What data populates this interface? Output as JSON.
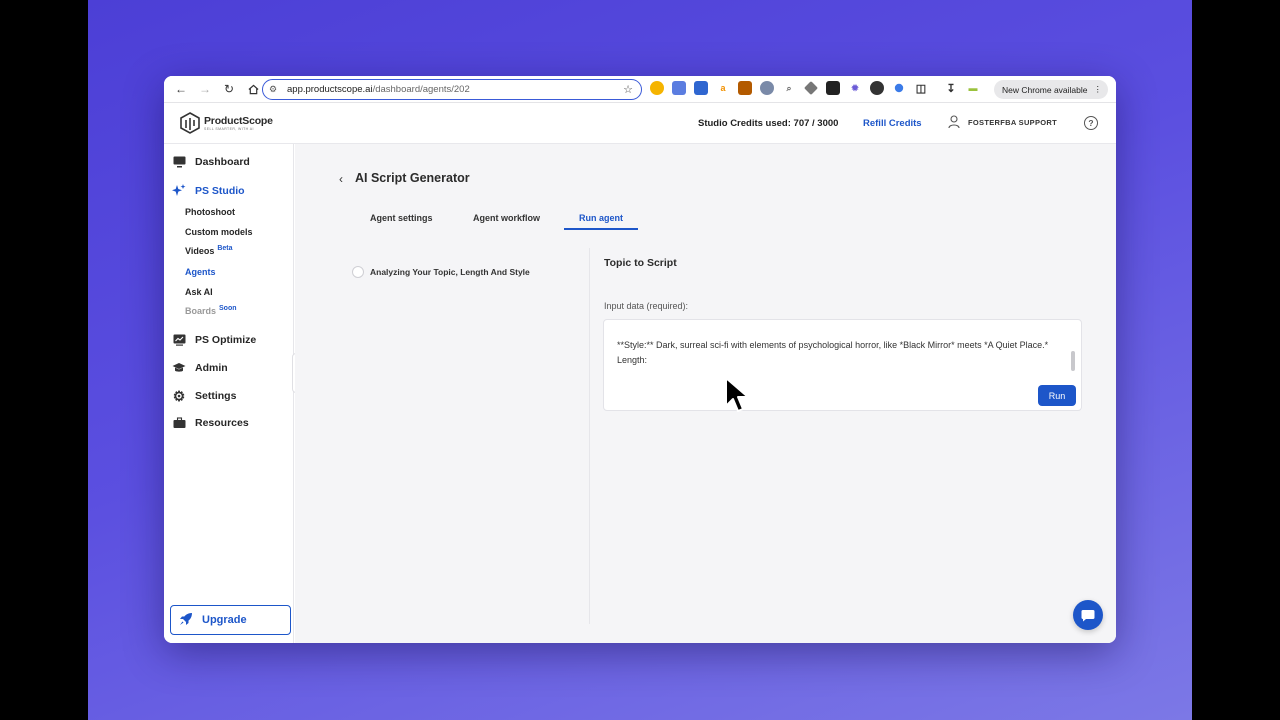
{
  "browser": {
    "url_host": "app.productscope.ai",
    "url_path": "/dashboard/agents/202",
    "new_chrome_label": "New Chrome available"
  },
  "header": {
    "brand_name": "ProductScope",
    "brand_tagline": "SELL SMARTER, WITH AI",
    "credits_label": "Studio Credits used: 707 / 3000",
    "refill_label": "Refill Credits",
    "user_name": "FOSTERFBA SUPPORT"
  },
  "sidebar": {
    "dashboard": "Dashboard",
    "ps_studio": "PS Studio",
    "studio_items": {
      "photoshoot": "Photoshoot",
      "custom_models": "Custom models",
      "videos": "Videos",
      "videos_badge": "Beta",
      "agents": "Agents",
      "ask_ai": "Ask AI",
      "boards": "Boards",
      "boards_badge": "Soon"
    },
    "ps_optimize": "PS Optimize",
    "admin": "Admin",
    "settings": "Settings",
    "resources": "Resources",
    "upgrade": "Upgrade"
  },
  "main": {
    "title": "AI Script Generator",
    "tabs": {
      "agent_settings": "Agent settings",
      "agent_workflow": "Agent workflow",
      "run_agent": "Run agent"
    },
    "step_label": "Analyzing Your Topic, Length And Style",
    "section_title": "Topic to Script",
    "input_label": "Input data (required):",
    "input_value": "**Style:** Dark, surreal sci-fi with elements of psychological horror, like *Black Mirror* meets *A Quiet Place.*\nLength:",
    "run_label": "Run"
  },
  "colors": {
    "accent": "#1d56c9",
    "background_gradient_start": "#4c3fd6",
    "background_gradient_end": "#7c78e6"
  }
}
